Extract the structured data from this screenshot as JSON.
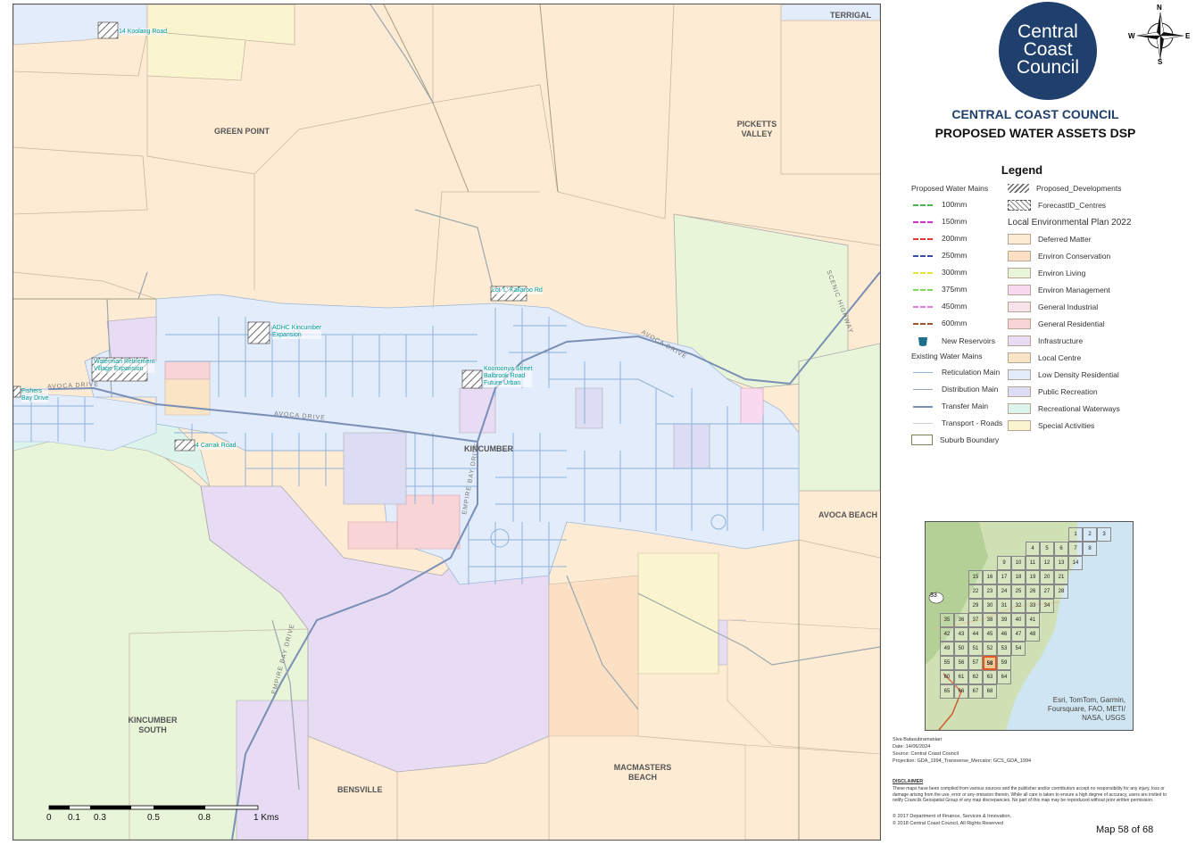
{
  "map": {
    "suburbs": [
      {
        "id": "terrigal",
        "label": "TERRIGAL"
      },
      {
        "id": "green-point",
        "label": "GREEN POINT"
      },
      {
        "id": "picketts-valley",
        "label": "PICKETTS\nVALLEY"
      },
      {
        "id": "kincumber",
        "label": "KINCUMBER"
      },
      {
        "id": "avoca-beach",
        "label": "AVOCA BEACH"
      },
      {
        "id": "kincumber-south",
        "label": "KINCUMBER\nSOUTH"
      },
      {
        "id": "macmasters-beach",
        "label": "MACMASTERS\nBEACH"
      },
      {
        "id": "bensville",
        "label": "BENSVILLE"
      }
    ],
    "roads": [
      {
        "id": "avoca-drive-1",
        "label": "AVOCA DRIVE"
      },
      {
        "id": "avoca-drive-2",
        "label": "AVOCA DRIVE"
      },
      {
        "id": "avoca-drive-3",
        "label": "AVOCA DRIVE"
      },
      {
        "id": "scenic-highway",
        "label": "SCENIC HIGHWAY"
      },
      {
        "id": "empire-bay-drive-1",
        "label": "EMPIRE BAY DRIVE"
      },
      {
        "id": "empire-bay-drive-2",
        "label": "EMPIRE BAY DRIVE"
      }
    ],
    "developments": [
      {
        "id": "koolang",
        "label": "14 Koolang Road"
      },
      {
        "id": "adhc",
        "label": "ADHC Kincumber\nExpansion"
      },
      {
        "id": "lot-l",
        "label": "Lot 'L' Kallaroo Rd"
      },
      {
        "id": "waterman",
        "label": "Waterman Retirement\nVillage Expansion"
      },
      {
        "id": "kooroonya",
        "label": "Kooroonya Street\nBalbrook Road\nFuture Urban"
      },
      {
        "id": "fishers",
        "label": "Fishers\nBay Drive"
      },
      {
        "id": "carrak",
        "label": "4 Carrak Road"
      }
    ],
    "scale_labels": [
      "0",
      "0.1",
      "0.3",
      "0.5",
      "0.8",
      "1 Kms"
    ],
    "scale_values_km": [
      0,
      0.1,
      0.3,
      0.5,
      0.8,
      1
    ]
  },
  "logo": {
    "line1": "Central",
    "line2": "Coast",
    "line3": "Council"
  },
  "compass": {
    "n": "N",
    "s": "S",
    "e": "E",
    "w": "W"
  },
  "title": {
    "org": "CENTRAL COAST COUNCIL",
    "subtitle": "PROPOSED WATER ASSETS DSP"
  },
  "legend": {
    "heading": "Legend",
    "proposed_mains_title": "Proposed Water Mains",
    "proposed_mains": [
      {
        "label": "100mm",
        "color": "#4caf50"
      },
      {
        "label": "150mm",
        "color": "#cc33cc"
      },
      {
        "label": "200mm",
        "color": "#e53935"
      },
      {
        "label": "250mm",
        "color": "#3949ab"
      },
      {
        "label": "300mm",
        "color": "#e8e23a"
      },
      {
        "label": "375mm",
        "color": "#7ed957"
      },
      {
        "label": "450mm",
        "color": "#e47be0"
      },
      {
        "label": "600mm",
        "color": "#a0522d"
      }
    ],
    "new_reservoirs": "New Reservoirs",
    "existing_mains_title": "Existing Water Mains",
    "existing_mains": [
      {
        "label": "Reticulation Main",
        "color": "#8fb2d8"
      },
      {
        "label": "Distribution Main",
        "color": "#9aa7b0"
      },
      {
        "label": "Transfer Main",
        "color": "#7a8fb5"
      },
      {
        "label": "Transport - Roads",
        "color": "#cccccc"
      }
    ],
    "suburb_boundary": "Suburb Boundary",
    "proposed_developments": "Proposed_Developments",
    "forecast_centres": "ForecastID_Centres",
    "lep_title": "Local Environmental Plan 2022",
    "lep": [
      {
        "label": "Deferred Matter",
        "color": "#fdebd3"
      },
      {
        "label": "Environ Conservation",
        "color": "#fbe0c4"
      },
      {
        "label": "Environ Living",
        "color": "#e8f5d8"
      },
      {
        "label": "Environ Management",
        "color": "#f9d9f0"
      },
      {
        "label": "General Industrial",
        "color": "#f7e3ea"
      },
      {
        "label": "General Residential",
        "color": "#f9d4d7"
      },
      {
        "label": "Infrastructure",
        "color": "#e8dcf5"
      },
      {
        "label": "Local Centre",
        "color": "#f9e5c6"
      },
      {
        "label": "Low Density Residential",
        "color": "#e2ecfa"
      },
      {
        "label": "Public Recreation",
        "color": "#dcdcf4"
      },
      {
        "label": "Recreational Waterways",
        "color": "#dcf4ec"
      },
      {
        "label": "Special Activities",
        "color": "#fbf5cf"
      }
    ]
  },
  "inset": {
    "attribution": "Esri, TomTom, Garmin,\nFoursquare, FAO, METI/\nNASA, USGS",
    "highway": "33",
    "current_map": "58"
  },
  "meta": {
    "author": "Siva Balasubramanian",
    "date": "Date: 14/06/2024",
    "source": "Source: Central Coast Council",
    "projection": "Projection: GDA_1994_Transverse_Mercator; GCS_GDA_1994",
    "disclaimer_title": "DISCLAIMER",
    "disclaimer": "These maps have been compiled from various sources and the publisher and/or contributors accept no responsibility for any injury, loss or damage arising from the use, error or any omission therein. While all care is taken to ensure a high degree of accuracy, users are invited to notify Councils Geospatial Group of any map discrepancies. No part of this map may be reproduced without prior written permission.",
    "copyright1": "© 2017 Department of Finance, Services & Innovation,",
    "copyright2": "© 2018 Central Coast Council, All Rights Reserved",
    "map_number": "Map 58 of 68"
  }
}
